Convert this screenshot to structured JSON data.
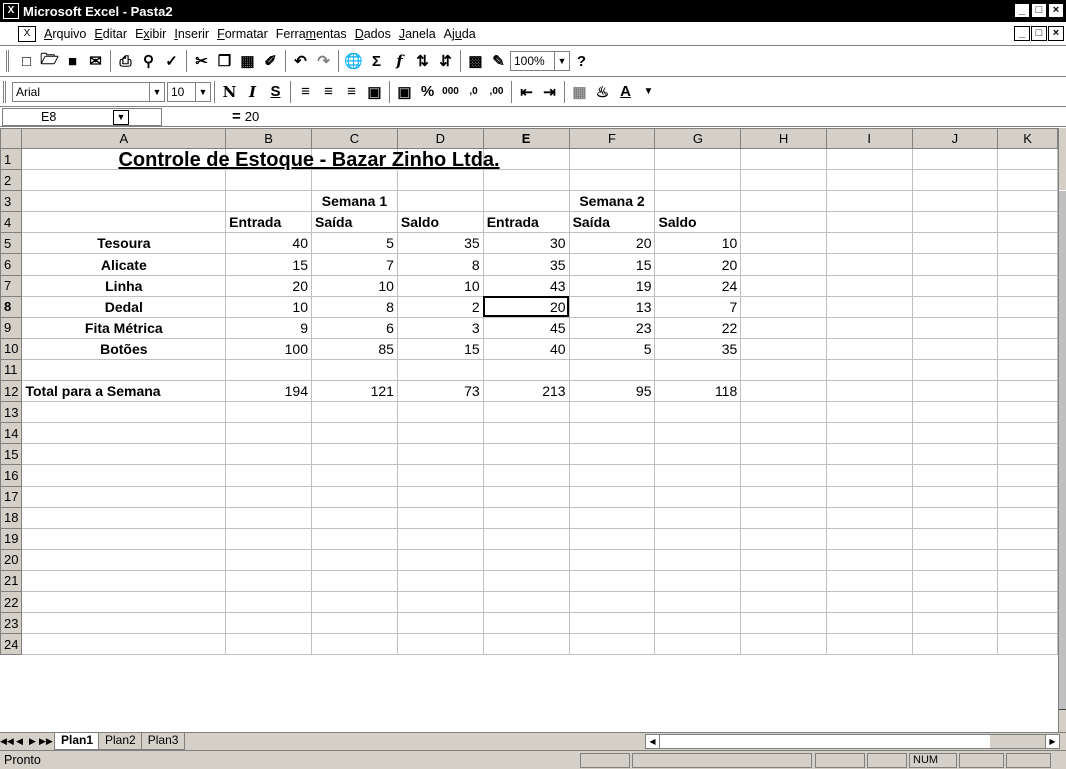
{
  "window": {
    "title": "Microsoft Excel - Pasta2",
    "app_icon": "excel-icon"
  },
  "window_buttons": [
    "_",
    "□",
    "×"
  ],
  "menu": [
    {
      "u": "A",
      "rest": "rquivo"
    },
    {
      "u": "E",
      "rest": "ditar"
    },
    {
      "pre": "E",
      "u": "x",
      "rest": "ibir"
    },
    {
      "u": "I",
      "rest": "nserir"
    },
    {
      "u": "F",
      "rest": "ormatar"
    },
    {
      "pre": "Ferra",
      "u": "m",
      "rest": "entas"
    },
    {
      "u": "D",
      "rest": "ados"
    },
    {
      "u": "J",
      "rest": "anela"
    },
    {
      "pre": "Aj",
      "u": "u",
      "rest": "da"
    }
  ],
  "standard_toolbar": {
    "zoom": "100%",
    "icons": [
      "new-icon",
      "open-icon",
      "save-icon",
      "email-icon",
      "print-icon",
      "print-preview-icon",
      "spelling-icon",
      "cut-icon",
      "copy-icon",
      "paste-icon",
      "format-painter-icon",
      "undo-icon",
      "redo-icon",
      "hyperlink-icon",
      "autosum-icon",
      "function-icon",
      "sort-asc-icon",
      "sort-desc-icon",
      "chart-wizard-icon",
      "drawing-icon",
      "help-icon"
    ]
  },
  "formatting_toolbar": {
    "font": "Arial",
    "size": "10",
    "bold": "N",
    "italic": "I",
    "underline": "S"
  },
  "formula_bar": {
    "cell_ref": "E8",
    "equals": "=",
    "value": "20"
  },
  "columns": [
    "A",
    "B",
    "C",
    "D",
    "E",
    "F",
    "G",
    "H",
    "I",
    "J",
    "K"
  ],
  "sheet": {
    "title": "Controle de Estoque  -  Bazar Zinho Ltda.",
    "week1": "Semana 1",
    "week2": "Semana 2",
    "subheaders": [
      "Entrada",
      "Saída",
      "Saldo",
      "Entrada",
      "Saída",
      "Saldo"
    ],
    "rows": [
      {
        "item": "Tesoura",
        "values": [
          "40",
          "5",
          "35",
          "30",
          "20",
          "10"
        ]
      },
      {
        "item": "Alicate",
        "values": [
          "15",
          "7",
          "8",
          "35",
          "15",
          "20"
        ]
      },
      {
        "item": "Linha",
        "values": [
          "20",
          "10",
          "10",
          "43",
          "19",
          "24"
        ]
      },
      {
        "item": "Dedal",
        "values": [
          "10",
          "8",
          "2",
          "20",
          "13",
          "7"
        ]
      },
      {
        "item": "Fita Métrica",
        "values": [
          "9",
          "6",
          "3",
          "45",
          "23",
          "22"
        ]
      },
      {
        "item": "Botões",
        "values": [
          "100",
          "85",
          "15",
          "40",
          "5",
          "35"
        ]
      }
    ],
    "total": {
      "label": "Total para a Semana",
      "values": [
        "194",
        "121",
        "73",
        "213",
        "95",
        "118"
      ]
    }
  },
  "tabs": [
    "Plan1",
    "Plan2",
    "Plan3"
  ],
  "status": {
    "text": "Pronto",
    "num": "NUM"
  }
}
